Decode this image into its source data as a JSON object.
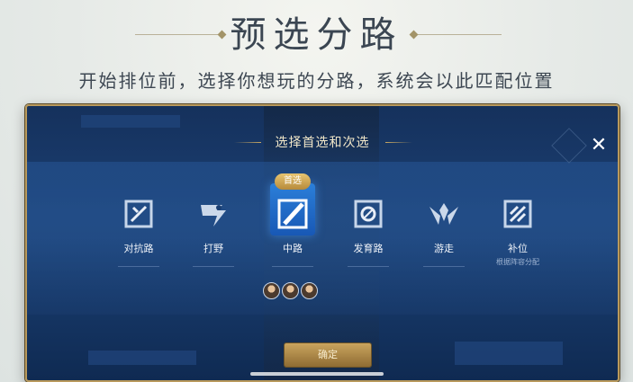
{
  "header": {
    "title": "预选分路",
    "subtitle": "开始排位前，选择你想玩的分路，系统会以此匹配位置"
  },
  "modal": {
    "title": "选择首选和次选",
    "close_icon": "close-icon",
    "primary_badge": "首选",
    "roles": [
      {
        "label": "对抗路",
        "sub": "",
        "icon": "clash-lane-icon"
      },
      {
        "label": "打野",
        "sub": "",
        "icon": "jungle-dragon-icon"
      },
      {
        "label": "中路",
        "sub": "",
        "icon": "mid-lane-icon"
      },
      {
        "label": "发育路",
        "sub": "",
        "icon": "farm-lane-icon"
      },
      {
        "label": "游走",
        "sub": "",
        "icon": "roam-wings-icon"
      },
      {
        "label": "补位",
        "sub": "根据阵容分配",
        "icon": "fill-icon"
      }
    ],
    "selected_role": "中路",
    "confirm_label": "确定"
  },
  "colors": {
    "panel": "#1b3f73",
    "border": "#b99a5d",
    "selected": "#2b7fd9",
    "confirm": "#c9a45e"
  }
}
